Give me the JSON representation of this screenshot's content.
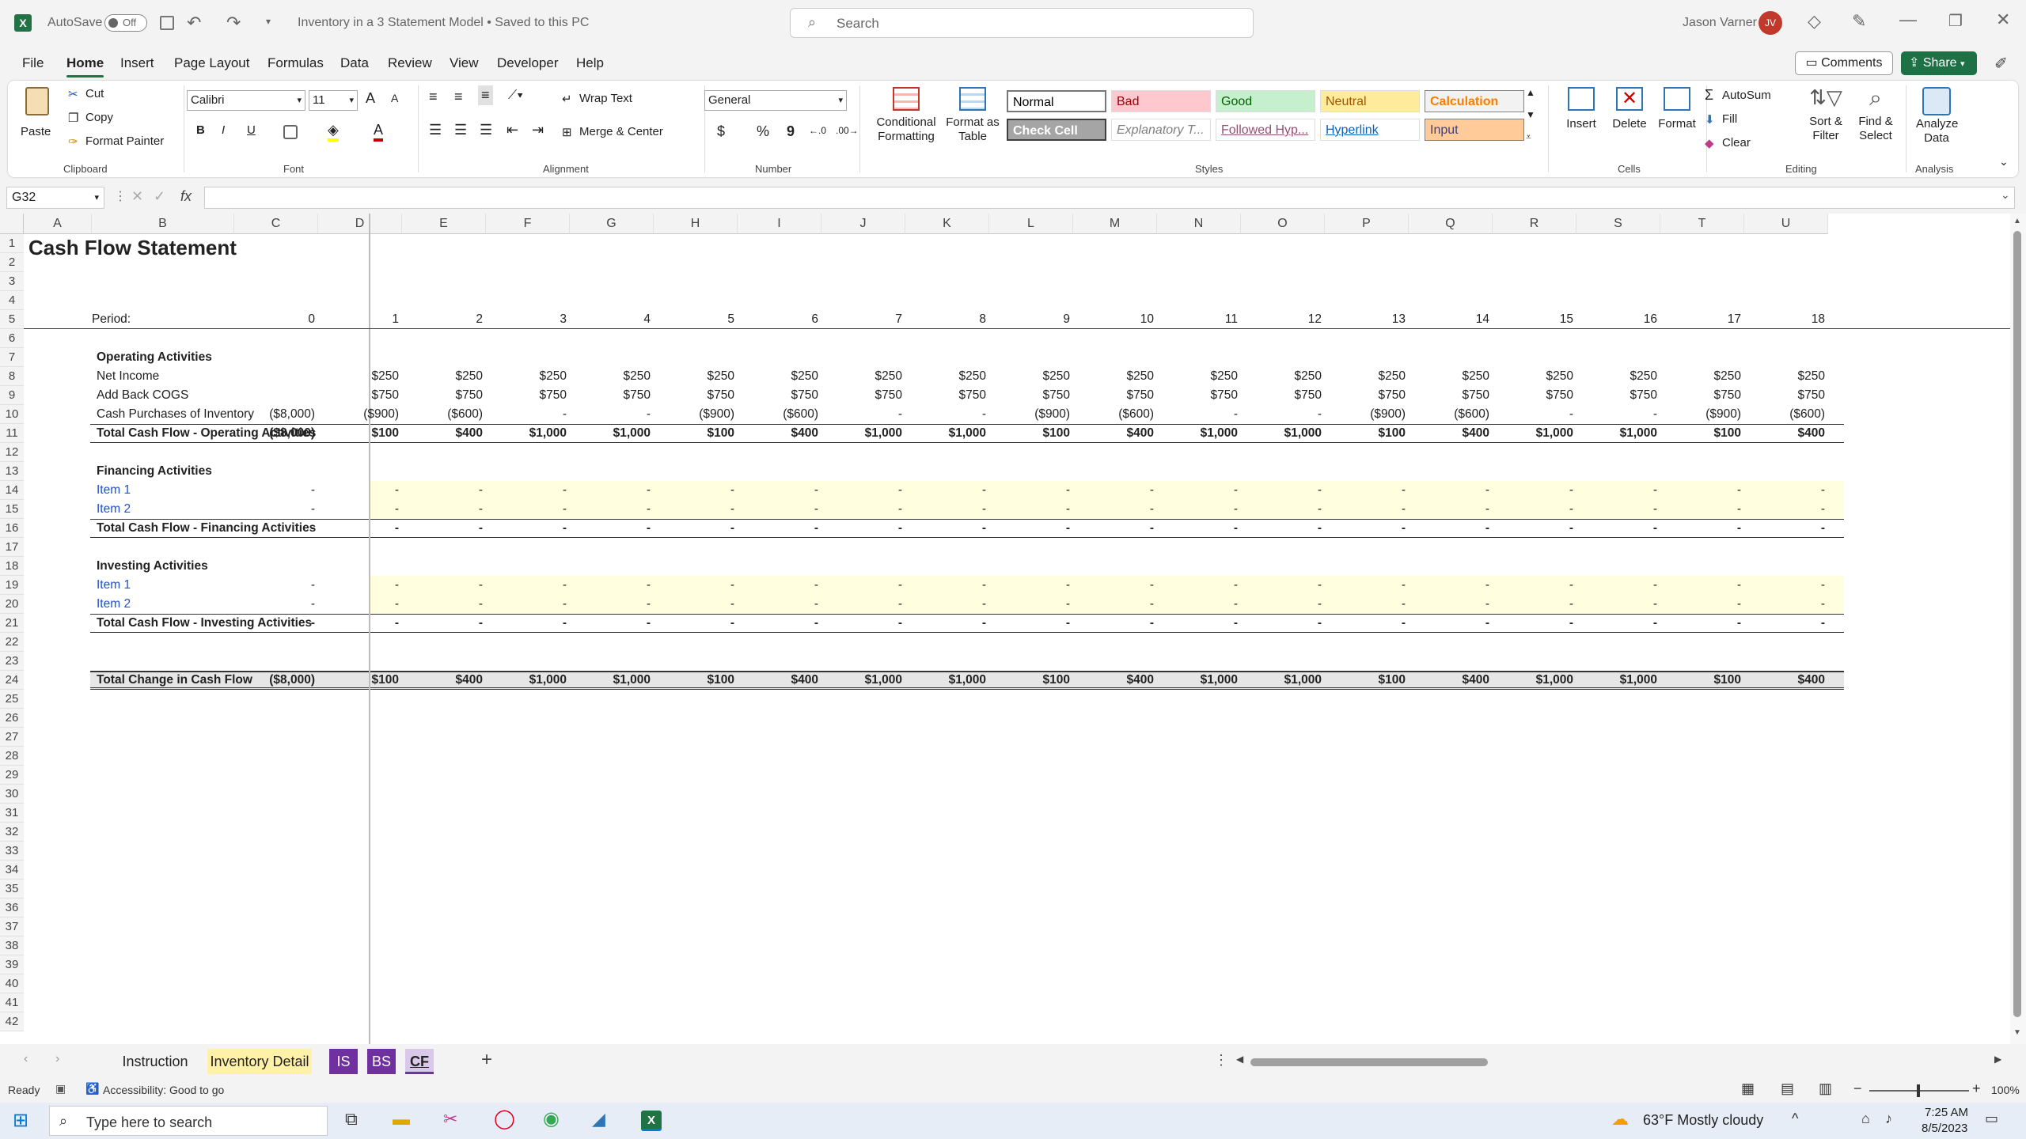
{
  "titlebar": {
    "autosave_label": "AutoSave",
    "autosave_state": "Off",
    "doc_title": "Inventory in a 3 Statement Model • Saved to this PC",
    "search_placeholder": "Search",
    "user_name": "Jason Varner",
    "user_initials": "JV"
  },
  "menu": {
    "items": [
      "File",
      "Home",
      "Insert",
      "Page Layout",
      "Formulas",
      "Data",
      "Review",
      "View",
      "Developer",
      "Help"
    ],
    "active": "Home",
    "comments": "Comments",
    "share": "Share"
  },
  "ribbon": {
    "clipboard": {
      "paste": "Paste",
      "cut": "Cut",
      "copy": "Copy",
      "format_painter": "Format Painter",
      "label": "Clipboard"
    },
    "font": {
      "name": "Calibri",
      "size": "11",
      "label": "Font",
      "bold": "B",
      "italic": "I",
      "underline": "U",
      "grow": "A",
      "shrink": "A",
      "font_color": "A"
    },
    "alignment": {
      "wrap": "Wrap Text",
      "merge": "Merge & Center",
      "label": "Alignment"
    },
    "number": {
      "format": "General",
      "currency": "$",
      "percent": "%",
      "comma": "9",
      "label": "Number"
    },
    "styles": {
      "conditional": "Conditional Formatting",
      "format_table": "Format as Table",
      "label": "Styles",
      "items": [
        {
          "name": "Normal",
          "bg": "#ffffff",
          "color": "#000000"
        },
        {
          "name": "Bad",
          "bg": "#ffc7ce",
          "color": "#9c0006"
        },
        {
          "name": "Good",
          "bg": "#c6efce",
          "color": "#006100"
        },
        {
          "name": "Neutral",
          "bg": "#ffeb9c",
          "color": "#9c5700"
        },
        {
          "name": "Calculation",
          "bg": "#f2f2f2",
          "color": "#fa7d00"
        },
        {
          "name": "Check Cell",
          "bg": "#a5a5a5",
          "color": "#ffffff"
        },
        {
          "name": "Explanatory T...",
          "bg": "#ffffff",
          "color": "#7f7f7f"
        },
        {
          "name": "Followed Hyp...",
          "bg": "#ffffff",
          "color": "#954f72"
        },
        {
          "name": "Hyperlink",
          "bg": "#ffffff",
          "color": "#0563c1"
        },
        {
          "name": "Input",
          "bg": "#ffcc99",
          "color": "#3f3f76"
        }
      ]
    },
    "cells": {
      "insert": "Insert",
      "delete": "Delete",
      "format": "Format",
      "label": "Cells"
    },
    "editing": {
      "autosum": "AutoSum",
      "fill": "Fill",
      "clear": "Clear",
      "sort": "Sort & Filter",
      "find": "Find & Select",
      "label": "Editing"
    },
    "analysis": {
      "analyze": "Analyze Data",
      "label": "Analysis"
    }
  },
  "formula_bar": {
    "name_box": "G32",
    "fx": "fx",
    "formula": ""
  },
  "grid": {
    "columns": [
      "A",
      "B",
      "C",
      "D",
      "E",
      "F",
      "G",
      "H",
      "I",
      "J",
      "K",
      "L",
      "M",
      "N",
      "O",
      "P",
      "Q",
      "R",
      "S",
      "T",
      "U"
    ],
    "row_numbers": [
      "1",
      "2",
      "3",
      "4",
      "5",
      "6",
      "7",
      "8",
      "9",
      "10",
      "11",
      "12",
      "13",
      "14",
      "15",
      "16",
      "17",
      "18",
      "19",
      "20",
      "21",
      "22",
      "23",
      "24",
      "25",
      "26",
      "27",
      "28",
      "29",
      "30",
      "31",
      "32",
      "33",
      "34",
      "35",
      "36",
      "37",
      "38",
      "39",
      "40",
      "41",
      "42"
    ],
    "title": "Cash Flow Statement",
    "period_label": "Period:",
    "periods": [
      "0",
      "1",
      "2",
      "3",
      "4",
      "5",
      "6",
      "7",
      "8",
      "9",
      "10",
      "11",
      "12",
      "13",
      "14",
      "15",
      "16",
      "17",
      "18"
    ],
    "sections": {
      "operating": "Operating Activities",
      "financing": "Financing Activities",
      "investing": "Investing Activities"
    },
    "rows": {
      "net_income": {
        "label": "Net Income",
        "values": [
          "",
          "$250",
          "$250",
          "$250",
          "$250",
          "$250",
          "$250",
          "$250",
          "$250",
          "$250",
          "$250",
          "$250",
          "$250",
          "$250",
          "$250",
          "$250",
          "$250",
          "$250",
          "$250"
        ]
      },
      "add_back_cogs": {
        "label": "Add Back COGS",
        "values": [
          "",
          "$750",
          "$750",
          "$750",
          "$750",
          "$750",
          "$750",
          "$750",
          "$750",
          "$750",
          "$750",
          "$750",
          "$750",
          "$750",
          "$750",
          "$750",
          "$750",
          "$750",
          "$750"
        ]
      },
      "cash_purchases": {
        "label": "Cash Purchases of Inventory",
        "values": [
          "($8,000)",
          "($900)",
          "($600)",
          "-",
          "-",
          "($900)",
          "($600)",
          "-",
          "-",
          "($900)",
          "($600)",
          "-",
          "-",
          "($900)",
          "($600)",
          "-",
          "-",
          "($900)",
          "($600)"
        ]
      },
      "total_operating": {
        "label": "Total Cash Flow - Operating Activities",
        "values": [
          "($8,000)",
          "$100",
          "$400",
          "$1,000",
          "$1,000",
          "$100",
          "$400",
          "$1,000",
          "$1,000",
          "$100",
          "$400",
          "$1,000",
          "$1,000",
          "$100",
          "$400",
          "$1,000",
          "$1,000",
          "$100",
          "$400"
        ]
      },
      "fin_item1": {
        "label": "Item 1",
        "values": [
          "-",
          "-",
          "-",
          "-",
          "-",
          "-",
          "-",
          "-",
          "-",
          "-",
          "-",
          "-",
          "-",
          "-",
          "-",
          "-",
          "-",
          "-",
          "-"
        ]
      },
      "fin_item2": {
        "label": "Item 2",
        "values": [
          "-",
          "-",
          "-",
          "-",
          "-",
          "-",
          "-",
          "-",
          "-",
          "-",
          "-",
          "-",
          "-",
          "-",
          "-",
          "-",
          "-",
          "-",
          "-"
        ]
      },
      "total_financing": {
        "label": "Total Cash Flow - Financing Activities",
        "values": [
          "-",
          "-",
          "-",
          "-",
          "-",
          "-",
          "-",
          "-",
          "-",
          "-",
          "-",
          "-",
          "-",
          "-",
          "-",
          "-",
          "-",
          "-",
          "-"
        ]
      },
      "inv_item1": {
        "label": "Item 1",
        "values": [
          "-",
          "-",
          "-",
          "-",
          "-",
          "-",
          "-",
          "-",
          "-",
          "-",
          "-",
          "-",
          "-",
          "-",
          "-",
          "-",
          "-",
          "-",
          "-"
        ]
      },
      "inv_item2": {
        "label": "Item 2",
        "values": [
          "-",
          "-",
          "-",
          "-",
          "-",
          "-",
          "-",
          "-",
          "-",
          "-",
          "-",
          "-",
          "-",
          "-",
          "-",
          "-",
          "-",
          "-",
          "-"
        ]
      },
      "total_investing": {
        "label": "Total Cash Flow - Investing Activities",
        "values": [
          "-",
          "-",
          "-",
          "-",
          "-",
          "-",
          "-",
          "-",
          "-",
          "-",
          "-",
          "-",
          "-",
          "-",
          "-",
          "-",
          "-",
          "-",
          "-"
        ]
      },
      "total_change": {
        "label": "Total Change in Cash Flow",
        "values": [
          "($8,000)",
          "$100",
          "$400",
          "$1,000",
          "$1,000",
          "$100",
          "$400",
          "$1,000",
          "$1,000",
          "$100",
          "$400",
          "$1,000",
          "$1,000",
          "$100",
          "$400",
          "$1,000",
          "$1,000",
          "$100",
          "$400"
        ]
      }
    },
    "input_fill": "#ffffe0"
  },
  "sheet_tabs": [
    {
      "name": "Instruction",
      "bg": "#f3f3f3",
      "color": "#222"
    },
    {
      "name": "Inventory Detail",
      "bg": "#fff2a8",
      "color": "#222"
    },
    {
      "name": "IS",
      "bg": "#7030a0",
      "color": "#ffffff"
    },
    {
      "name": "BS",
      "bg": "#7030a0",
      "color": "#ffffff"
    },
    {
      "name": "CF",
      "bg": "#d9c8ea",
      "color": "#222"
    }
  ],
  "status": {
    "ready": "Ready",
    "accessibility": "Accessibility: Good to go",
    "zoom": "100%"
  },
  "taskbar": {
    "search_placeholder": "Type here to search",
    "weather": "63°F Mostly cloudy",
    "time": "7:25 AM",
    "date": "8/5/2023"
  },
  "colors": {
    "excel_green": "#217346",
    "share_green": "#1e7145"
  }
}
